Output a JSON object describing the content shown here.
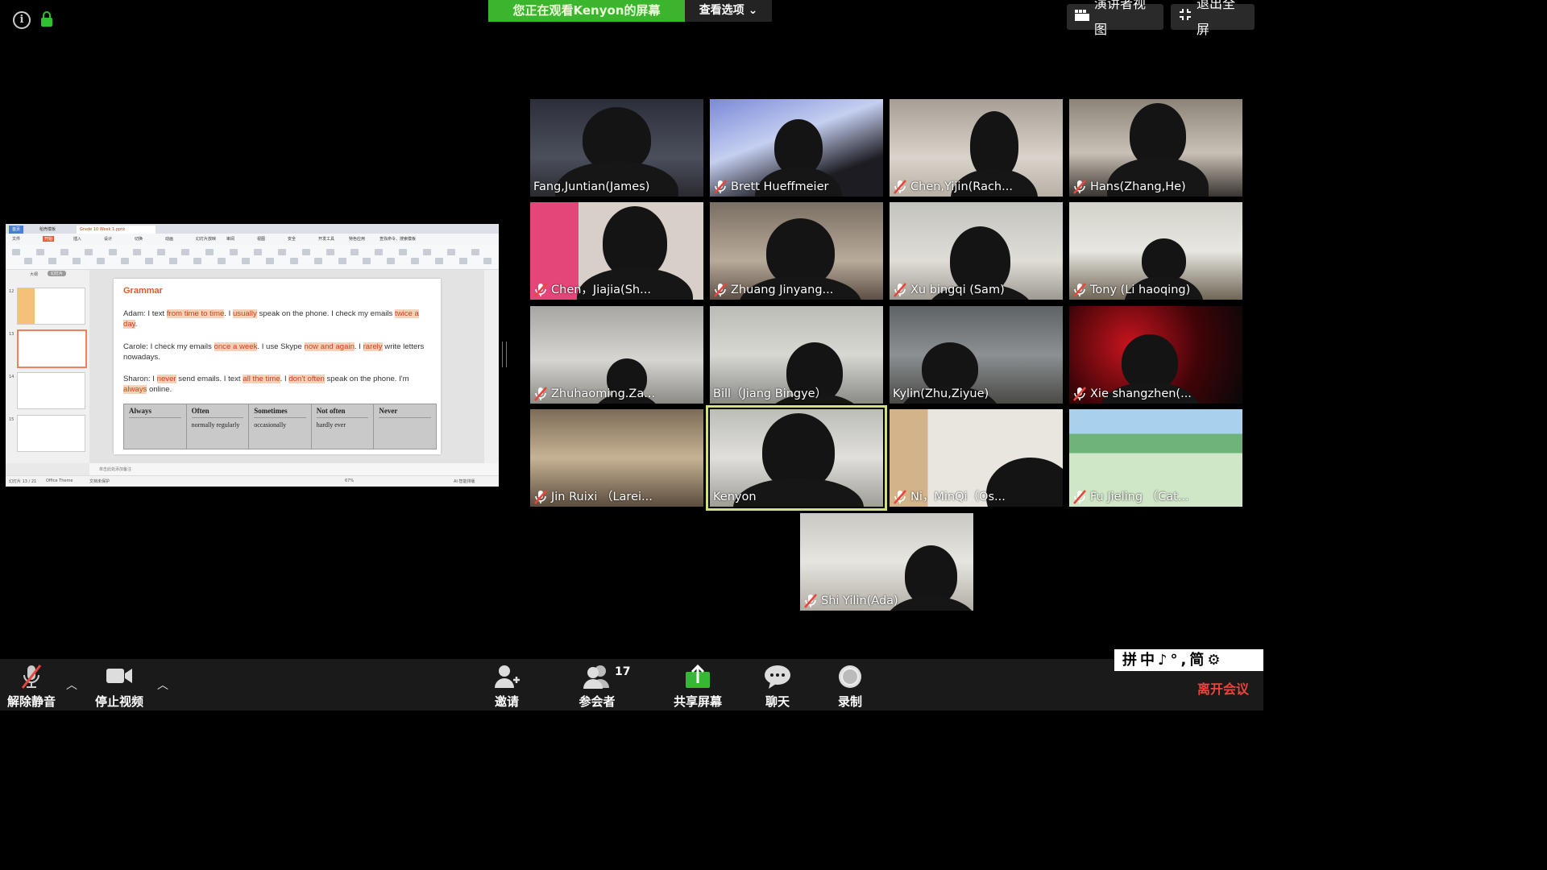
{
  "banner": {
    "message": "您正在观看Kenyon的屏幕",
    "options_label": "查看选项"
  },
  "top_right": {
    "speaker_view": "演讲者视图",
    "exit_fullscreen": "退出全屏"
  },
  "shared_screen": {
    "window_tab": "Grade 10 Week 1.pptx",
    "home_tab": "首页",
    "template_tab": "稻壳模板",
    "menu": [
      "文件",
      "开始",
      "插入",
      "设计",
      "切换",
      "动画",
      "幻灯片放映",
      "审阅",
      "视图",
      "安全",
      "开发工具",
      "特色应用",
      "查找命令、搜索模板"
    ],
    "panel_tabs": [
      "大纲",
      "幻灯片"
    ],
    "slide_numbers": [
      "12",
      "13",
      "14",
      "15"
    ],
    "slide": {
      "title": "Grammar",
      "p1_a": "Adam: I text ",
      "p1_h1": "from time to time",
      "p1_b": ". I ",
      "p1_h2": "usually",
      "p1_c": " speak on the phone. I check my emails ",
      "p1_h3": "twice a day",
      "p1_d": ".",
      "p2_a": "Carole: I check my emails ",
      "p2_h1": "once a week",
      "p2_b": ". I use Skype ",
      "p2_h2": "now and again",
      "p2_c": ". I ",
      "p2_h3": "rarely",
      "p2_d": " write letters nowadays.",
      "p3_a": "Sharon: I ",
      "p3_h1": "never",
      "p3_b": " send emails. I text ",
      "p3_h2": "all the time",
      "p3_c": ". I ",
      "p3_h3": "don't often",
      "p3_d": " speak on the phone. I'm ",
      "p3_h4": "always",
      "p3_e": " online.",
      "table": {
        "headers": [
          "Always",
          "Often",
          "Sometimes",
          "Not often",
          "Never"
        ],
        "cells": [
          "",
          "normally regularly",
          "occasionally",
          "hardly ever",
          ""
        ]
      }
    },
    "notes_hint": "单击此处添加备注",
    "status_left": "幻灯片 13 / 21",
    "status_theme": "Office Theme",
    "status_backup": "文档未保护",
    "zoom": "67%",
    "ai_label": "AI·智能排版"
  },
  "participants": [
    {
      "name": "Fang,Juntian(James)",
      "muted": false
    },
    {
      "name": "Brett Hueffmeier",
      "muted": true
    },
    {
      "name": "Chen,Yijin(Rach...",
      "muted": true
    },
    {
      "name": "Hans(Zhang,He)",
      "muted": true
    },
    {
      "name": "Chen，Jiajia(Sh...",
      "muted": true
    },
    {
      "name": "Zhuang Jinyang...",
      "muted": true
    },
    {
      "name": "Xu bingqi (Sam)",
      "muted": true
    },
    {
      "name": "Tony (Li haoqing)",
      "muted": true
    },
    {
      "name": "Zhuhaoming.Za...",
      "muted": true
    },
    {
      "name": "Bill（Jiang Bingye）",
      "muted": false
    },
    {
      "name": "Kylin(Zhu,Ziyue)",
      "muted": false
    },
    {
      "name": "Xie shangzhen(...",
      "muted": true
    },
    {
      "name": "Jin Ruixi （Larei...",
      "muted": true
    },
    {
      "name": "Kenyon",
      "muted": false
    },
    {
      "name": "Ni，MinQi（Os...",
      "muted": true
    },
    {
      "name": "Fu Jieling （Cat...",
      "muted": true
    },
    {
      "name": "Shi Yilin(Ada)",
      "muted": true
    }
  ],
  "toolbar": {
    "unmute": "解除静音",
    "stop_video": "停止视频",
    "invite": "邀请",
    "participants": "参会者",
    "participant_count": "17",
    "share": "共享屏幕",
    "chat": "聊天",
    "record": "录制",
    "leave": "离开会议"
  },
  "ime": {
    "text": "拼中♪°,简⚙"
  },
  "colors": {
    "banner_green": "#3bb52e",
    "leave_red": "#e8453c",
    "active_outline": "#d4e07a",
    "slide_accent": "#e05a2a"
  }
}
